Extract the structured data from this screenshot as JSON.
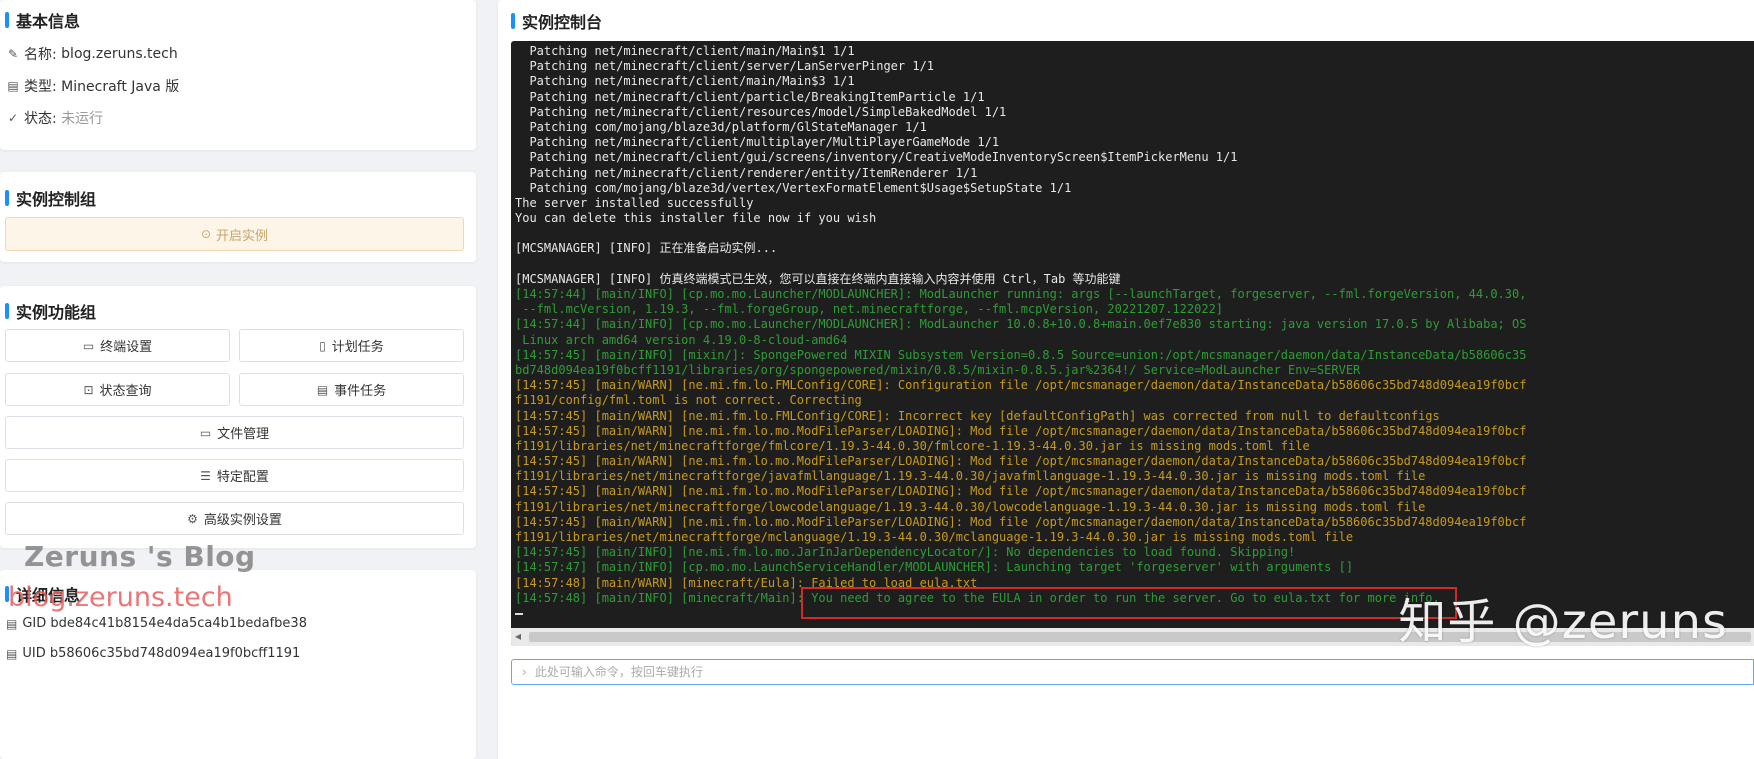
{
  "basic": {
    "title": "基本信息",
    "name_label": "名称:",
    "name_value": "blog.zeruns.tech",
    "type_label": "类型:",
    "type_value": "Minecraft Java 版",
    "status_label": "状态:",
    "status_value": "未运行"
  },
  "control": {
    "title": "实例控制组",
    "start_label": "开启实例"
  },
  "functions": {
    "title": "实例功能组",
    "terminal_settings": "终端设置",
    "scheduled_tasks": "计划任务",
    "status_query": "状态查询",
    "event_tasks": "事件任务",
    "file_management": "文件管理",
    "specific_config": "特定配置",
    "advanced_settings": "高级实例设置"
  },
  "detail": {
    "title": "详细信息",
    "gid": "GID bde84c41b8154e4da5ca4b1bedafbe38",
    "uid": "UID b58606c35bd748d094ea19f0bcff1191"
  },
  "watermarks": {
    "blog": "Zeruns 's Blog",
    "url": "blog.zeruns.tech",
    "zhihu": "知乎 @zeruns"
  },
  "console": {
    "title": "实例控制台",
    "input_placeholder": "此处可输入命令，按回车键执行",
    "lines": [
      {
        "text": "  Patching net/minecraft/client/main/Main$1 1/1",
        "color": "w"
      },
      {
        "text": "  Patching net/minecraft/client/server/LanServerPinger 1/1",
        "color": "w"
      },
      {
        "text": "  Patching net/minecraft/client/main/Main$3 1/1",
        "color": "w"
      },
      {
        "text": "  Patching net/minecraft/client/particle/BreakingItemParticle 1/1",
        "color": "w"
      },
      {
        "text": "  Patching net/minecraft/client/resources/model/SimpleBakedModel 1/1",
        "color": "w"
      },
      {
        "text": "  Patching com/mojang/blaze3d/platform/GlStateManager 1/1",
        "color": "w"
      },
      {
        "text": "  Patching net/minecraft/client/multiplayer/MultiPlayerGameMode 1/1",
        "color": "w"
      },
      {
        "text": "  Patching net/minecraft/client/gui/screens/inventory/CreativeModeInventoryScreen$ItemPickerMenu 1/1",
        "color": "w"
      },
      {
        "text": "  Patching net/minecraft/client/renderer/entity/ItemRenderer 1/1",
        "color": "w"
      },
      {
        "text": "  Patching com/mojang/blaze3d/vertex/VertexFormatElement$Usage$SetupState 1/1",
        "color": "w"
      },
      {
        "text": "The server installed successfully",
        "color": "w"
      },
      {
        "text": "You can delete this installer file now if you wish",
        "color": "w"
      },
      {
        "text": "",
        "color": "w"
      },
      {
        "text": "[MCSMANAGER] [INFO] 正在准备启动实例...",
        "color": "w"
      },
      {
        "text": "",
        "color": "w"
      },
      {
        "text": "[MCSMANAGER] [INFO] 仿真终端模式已生效，您可以直接在终端内直接输入内容并使用 Ctrl，Tab 等功能键",
        "color": "w"
      },
      {
        "text": "[14:57:44] [main/INFO] [cp.mo.mo.Launcher/MODLAUNCHER]: ModLauncher running: args [--launchTarget, forgeserver, --fml.forgeVersion, 44.0.30,",
        "color": "g"
      },
      {
        "text": " --fml.mcVersion, 1.19.3, --fml.forgeGroup, net.minecraftforge, --fml.mcpVersion, 20221207.122022]",
        "color": "g"
      },
      {
        "text": "[14:57:44] [main/INFO] [cp.mo.mo.Launcher/MODLAUNCHER]: ModLauncher 10.0.8+10.0.8+main.0ef7e830 starting: java version 17.0.5 by Alibaba; OS",
        "color": "g"
      },
      {
        "text": " Linux arch amd64 version 4.19.0-8-cloud-amd64",
        "color": "g"
      },
      {
        "text": "[14:57:45] [main/INFO] [mixin/]: SpongePowered MIXIN Subsystem Version=0.8.5 Source=union:/opt/mcsmanager/daemon/data/InstanceData/b58606c35",
        "color": "g"
      },
      {
        "text": "bd748d094ea19f0bcff1191/libraries/org/spongepowered/mixin/0.8.5/mixin-0.8.5.jar%2364!/ Service=ModLauncher Env=SERVER",
        "color": "g"
      },
      {
        "text": "[14:57:45] [main/WARN] [ne.mi.fm.lo.FMLConfig/CORE]: Configuration file /opt/mcsmanager/daemon/data/InstanceData/b58606c35bd748d094ea19f0bcf",
        "color": "y"
      },
      {
        "text": "f1191/config/fml.toml is not correct. Correcting",
        "color": "y"
      },
      {
        "text": "[14:57:45] [main/WARN] [ne.mi.fm.lo.FMLConfig/CORE]: Incorrect key [defaultConfigPath] was corrected from null to defaultconfigs",
        "color": "y"
      },
      {
        "text": "[14:57:45] [main/WARN] [ne.mi.fm.lo.mo.ModFileParser/LOADING]: Mod file /opt/mcsmanager/daemon/data/InstanceData/b58606c35bd748d094ea19f0bcf",
        "color": "y"
      },
      {
        "text": "f1191/libraries/net/minecraftforge/fmlcore/1.19.3-44.0.30/fmlcore-1.19.3-44.0.30.jar is missing mods.toml file",
        "color": "y"
      },
      {
        "text": "[14:57:45] [main/WARN] [ne.mi.fm.lo.mo.ModFileParser/LOADING]: Mod file /opt/mcsmanager/daemon/data/InstanceData/b58606c35bd748d094ea19f0bcf",
        "color": "y"
      },
      {
        "text": "f1191/libraries/net/minecraftforge/javafmllanguage/1.19.3-44.0.30/javafmllanguage-1.19.3-44.0.30.jar is missing mods.toml file",
        "color": "y"
      },
      {
        "text": "[14:57:45] [main/WARN] [ne.mi.fm.lo.mo.ModFileParser/LOADING]: Mod file /opt/mcsmanager/daemon/data/InstanceData/b58606c35bd748d094ea19f0bcf",
        "color": "y"
      },
      {
        "text": "f1191/libraries/net/minecraftforge/lowcodelanguage/1.19.3-44.0.30/lowcodelanguage-1.19.3-44.0.30.jar is missing mods.toml file",
        "color": "y"
      },
      {
        "text": "[14:57:45] [main/WARN] [ne.mi.fm.lo.mo.ModFileParser/LOADING]: Mod file /opt/mcsmanager/daemon/data/InstanceData/b58606c35bd748d094ea19f0bcf",
        "color": "y"
      },
      {
        "text": "f1191/libraries/net/minecraftforge/mclanguage/1.19.3-44.0.30/mclanguage-1.19.3-44.0.30.jar is missing mods.toml file",
        "color": "y"
      },
      {
        "text": "[14:57:45] [main/INFO] [ne.mi.fm.lo.mo.JarInJarDependencyLocator/]: No dependencies to load found. Skipping!",
        "color": "g"
      },
      {
        "text": "[14:57:47] [main/INFO] [cp.mo.mo.LaunchServiceHandler/MODLAUNCHER]: Launching target 'forgeserver' with arguments []",
        "color": "g"
      },
      {
        "text": "[14:57:48] [main/WARN] [minecraft/Eula]: Failed to load eula.txt",
        "color": "y"
      },
      {
        "text": "[14:57:48] [main/INFO] [minecraft/Main]: You need to agree to the EULA in order to run the server. Go to eula.txt for more info.",
        "color": "g"
      }
    ]
  },
  "colors": {
    "accent": "#1890ff",
    "terminal_bg": "#1e1e1e",
    "info_green": "#2e9d36",
    "warn_yellow": "#c79a1d",
    "highlight_red": "#d22a2a"
  }
}
